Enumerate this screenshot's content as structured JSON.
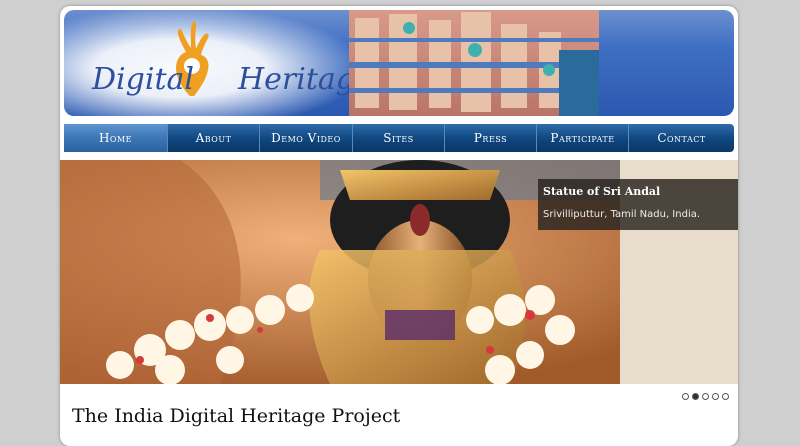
{
  "site": {
    "logo_word1": "Digital",
    "logo_word2": "Heritage"
  },
  "nav": {
    "items": [
      {
        "label": "Home",
        "active": true
      },
      {
        "label": "About",
        "active": false
      },
      {
        "label": "Demo Video",
        "active": false
      },
      {
        "label": "Sites",
        "active": false
      },
      {
        "label": "Press",
        "active": false
      },
      {
        "label": "Participate",
        "active": false
      },
      {
        "label": "Contact",
        "active": false
      }
    ]
  },
  "slider": {
    "caption_title": "Statue of Sri Andal",
    "caption_subtitle": "Srivilliputtur, Tamil Nadu, India.",
    "slide_count": 5,
    "active_slide": 2
  },
  "main": {
    "title": "The India Digital Heritage Project"
  },
  "colors": {
    "nav_bg": "#0e467e",
    "header_blue": "#3f6fc3",
    "logo_orange": "#f0a020",
    "logo_text": "#2d4f9e"
  }
}
